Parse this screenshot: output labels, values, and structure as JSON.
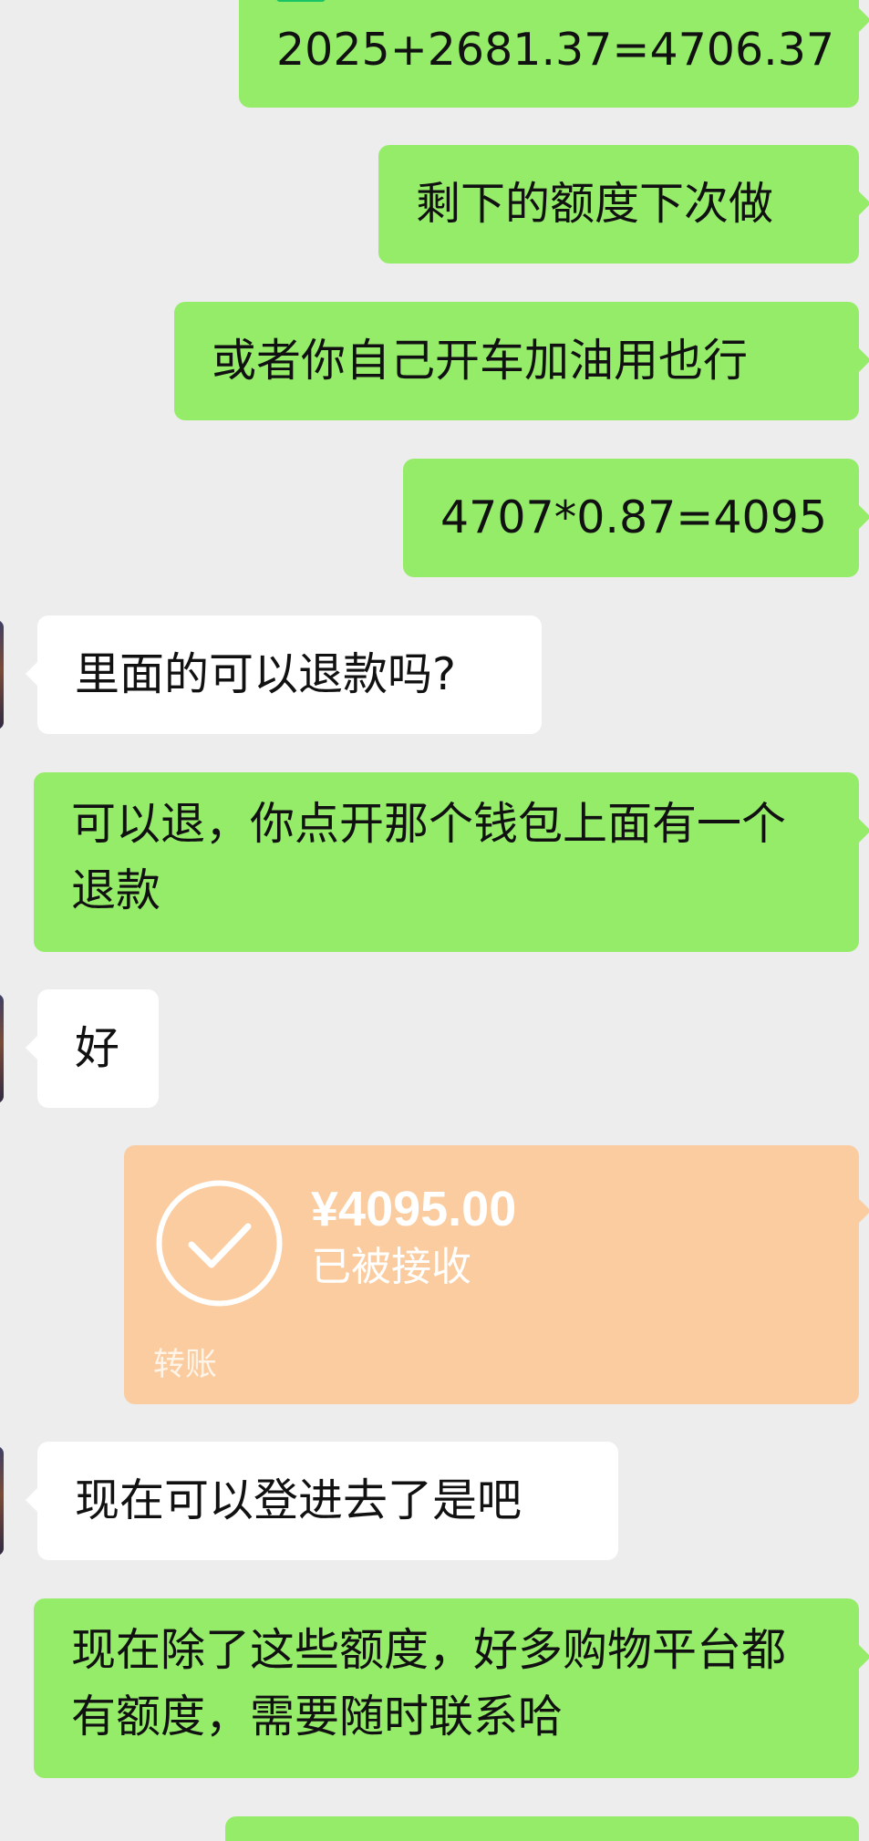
{
  "colors": {
    "background": "#ededed",
    "outgoing_bubble": "#95ec69",
    "incoming_bubble": "#ffffff",
    "transfer_card": "#facc9f",
    "check_badge": "#18c463"
  },
  "icons": {
    "check_badge": "green-check-mark-emoji",
    "transfer": "circle-check-icon"
  },
  "messages": {
    "m0_line1": "",
    "m0_line2": "2025+2681.37=4706.37",
    "m1": "剩下的额度下次做",
    "m2": "或者你自己开车加油用也行",
    "m3": "4707*0.87=4095",
    "m4": "里面的可以退款吗?",
    "m5": "可以退，你点开那个钱包上面有一个退款",
    "m6": "好",
    "m7": "现在可以登进去了是吧",
    "m8": "现在除了这些额度，好多购物平台都有额度，需要随时联系哈"
  },
  "transfer": {
    "amount": "¥4095.00",
    "status": "已被接收",
    "label": "转账"
  }
}
